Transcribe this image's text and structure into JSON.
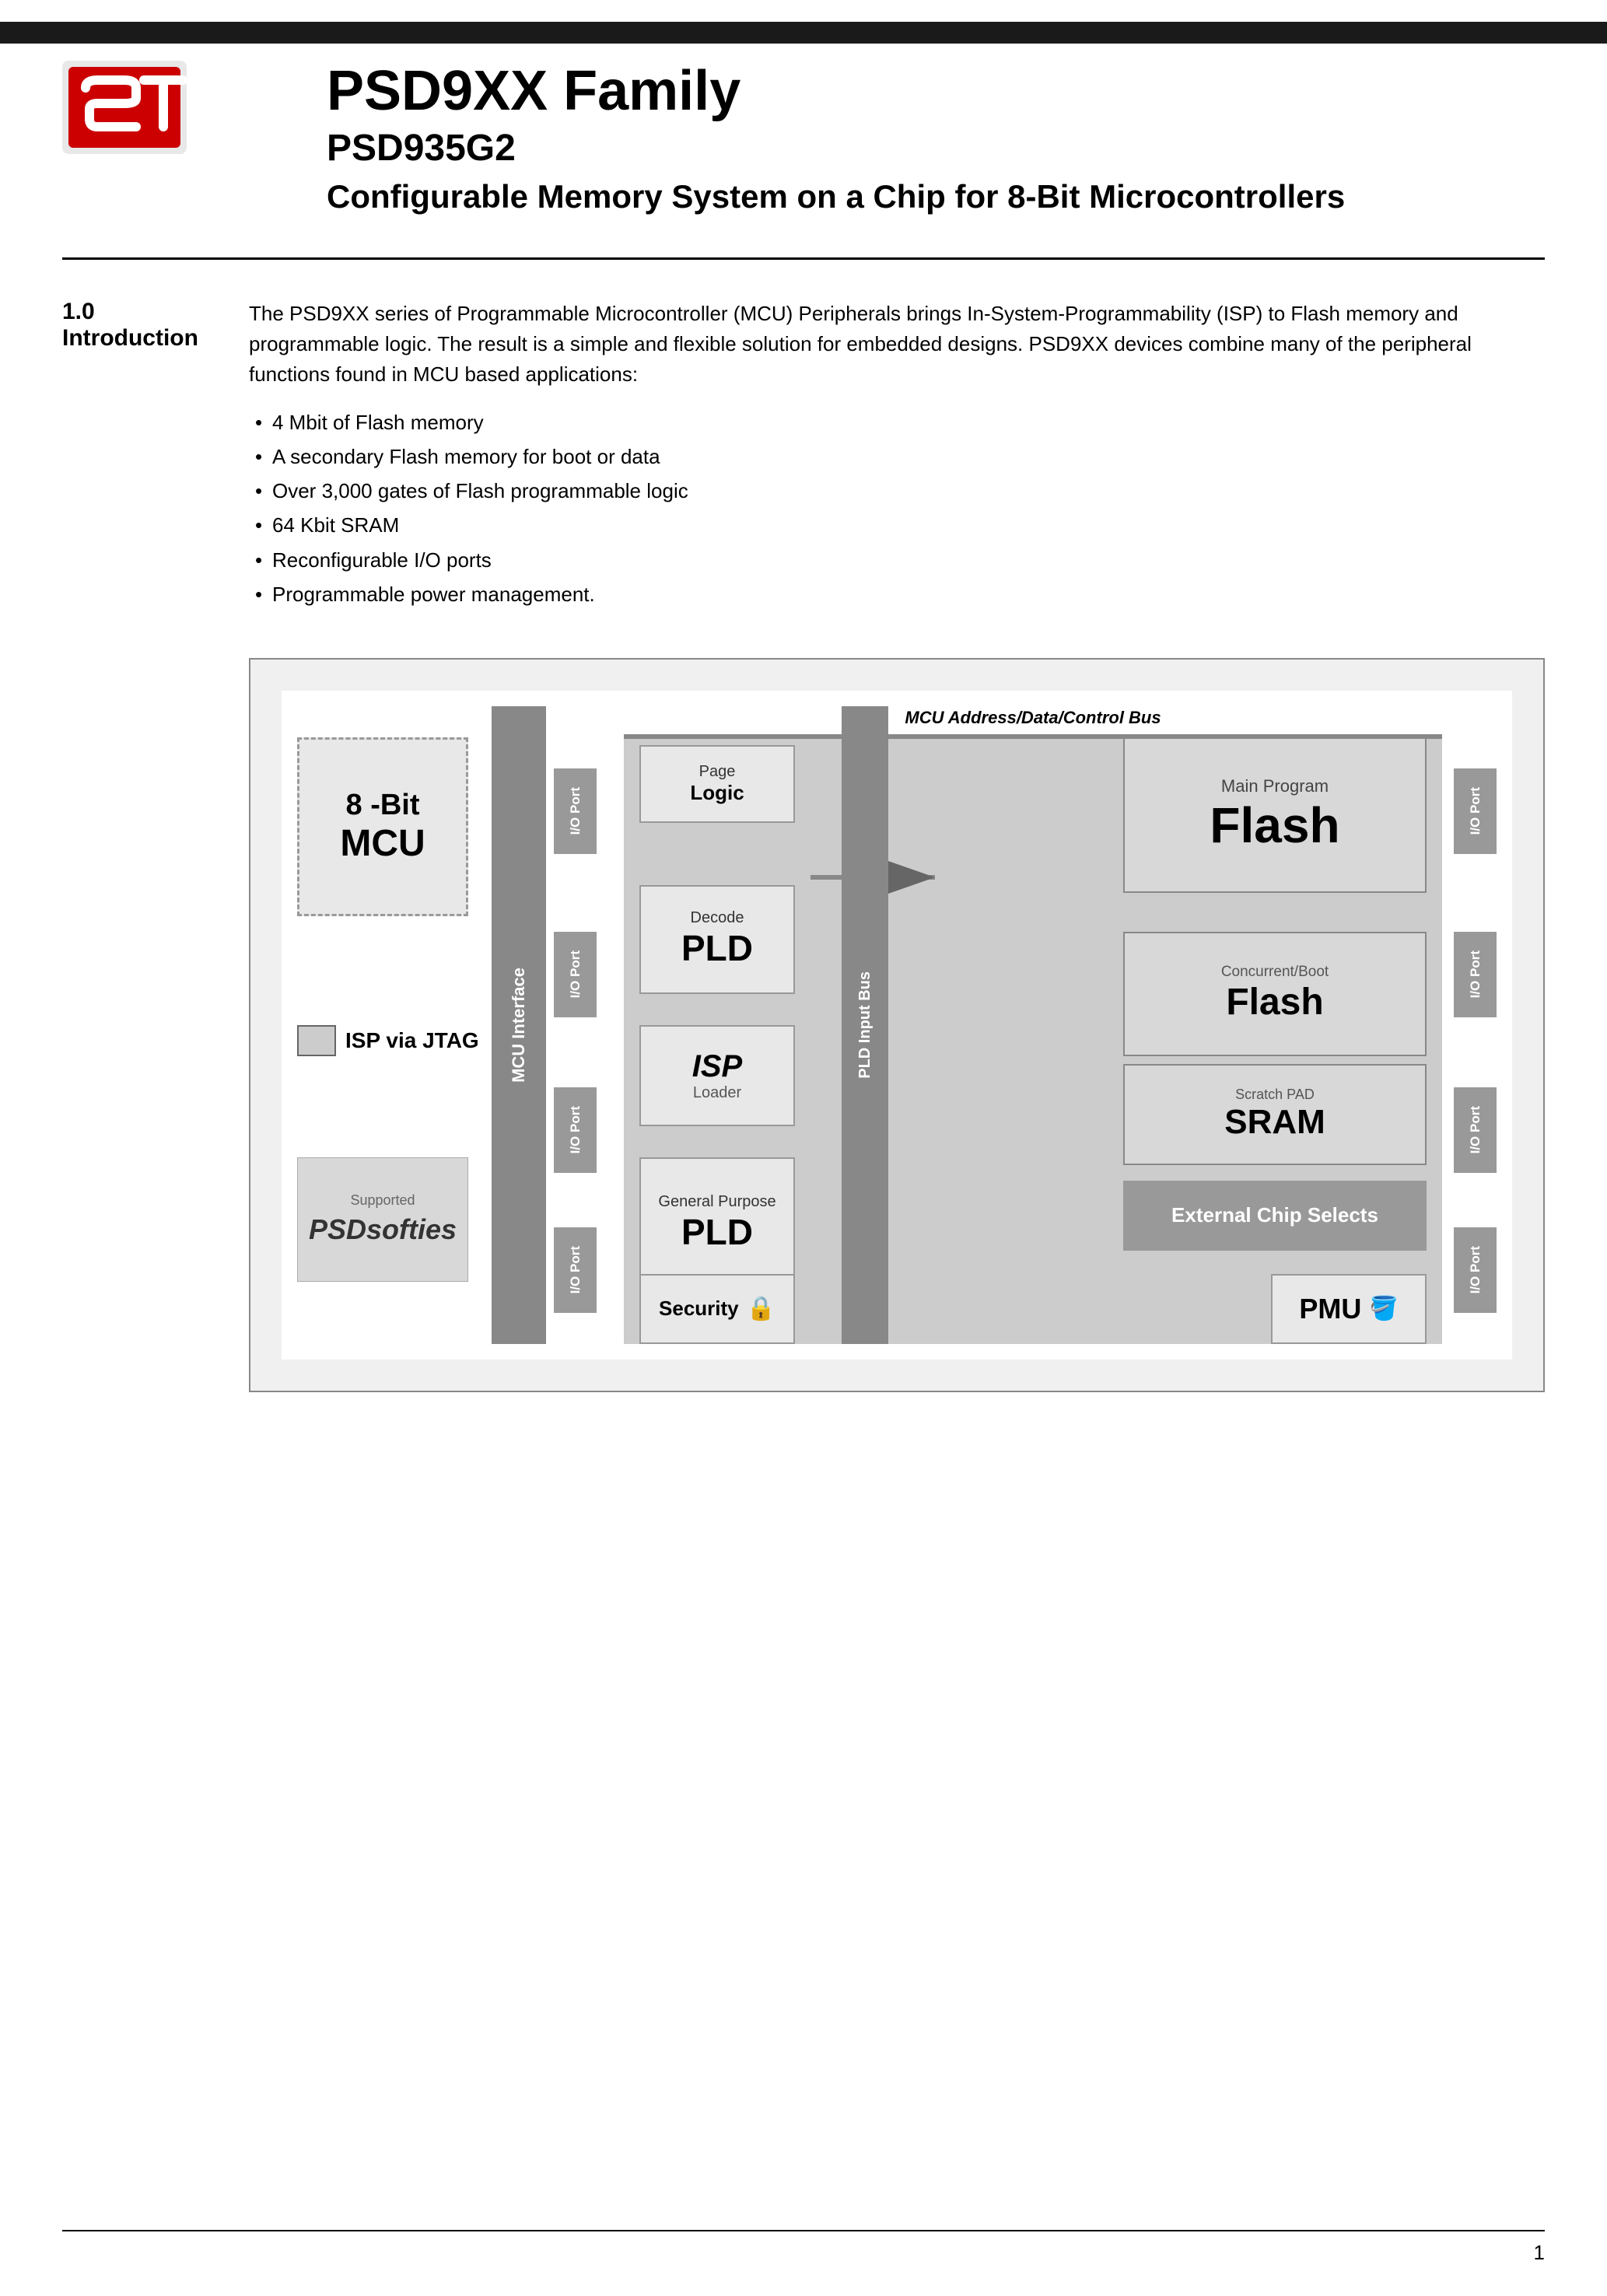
{
  "header": {
    "bar_color": "#1a1a1a",
    "logo_alt": "ST Microelectronics Logo",
    "main_title": "PSD9XX Family",
    "sub_title": "PSD935G2",
    "description": "Configurable Memory System on a Chip for 8-Bit Microcontrollers"
  },
  "section": {
    "number": "1.0",
    "name": "Introduction",
    "intro_paragraph": "The PSD9XX series of Programmable Microcontroller (MCU) Peripherals brings In-System-Programmability (ISP) to Flash memory and programmable logic. The result is a simple and flexible solution for embedded designs. PSD9XX devices combine many of the peripheral functions found in MCU based applications:",
    "bullets": [
      "4 Mbit of Flash memory",
      "A secondary Flash memory for boot or data",
      "Over 3,000 gates of Flash programmable logic",
      "64 Kbit SRAM",
      "Reconfigurable I/O ports",
      "Programmable power management."
    ]
  },
  "diagram": {
    "bus_label": "MCU Address/Data/Control Bus",
    "mcu_label_bit": "8 -Bit",
    "mcu_label_mcu": "MCU",
    "isp_jtag": "ISP via JTAG",
    "supported_text": "Supported",
    "psd_logo": "PSDsofties",
    "mcu_interface": "MCU Interface",
    "pld_input_bus": "PLD Input Bus",
    "page_logic_small": "Page",
    "page_logic_large": "Logic",
    "decode_small": "Decode",
    "pld_large": "PLD",
    "isp_italic": "ISP",
    "loader": "Loader",
    "general_purpose": "General Purpose",
    "main_program_small": "Main Program",
    "flash_large": "Flash",
    "concurrent_small": "Concurrent/Boot",
    "flash_medium": "Flash",
    "scratch_small": "Scratch PAD",
    "sram_large": "SRAM",
    "ext_chip_selects": "External Chip Selects",
    "security_text": "Security",
    "pmu_text": "PMU",
    "io_port_label": "I/O Port"
  },
  "footer": {
    "page_number": "1"
  }
}
